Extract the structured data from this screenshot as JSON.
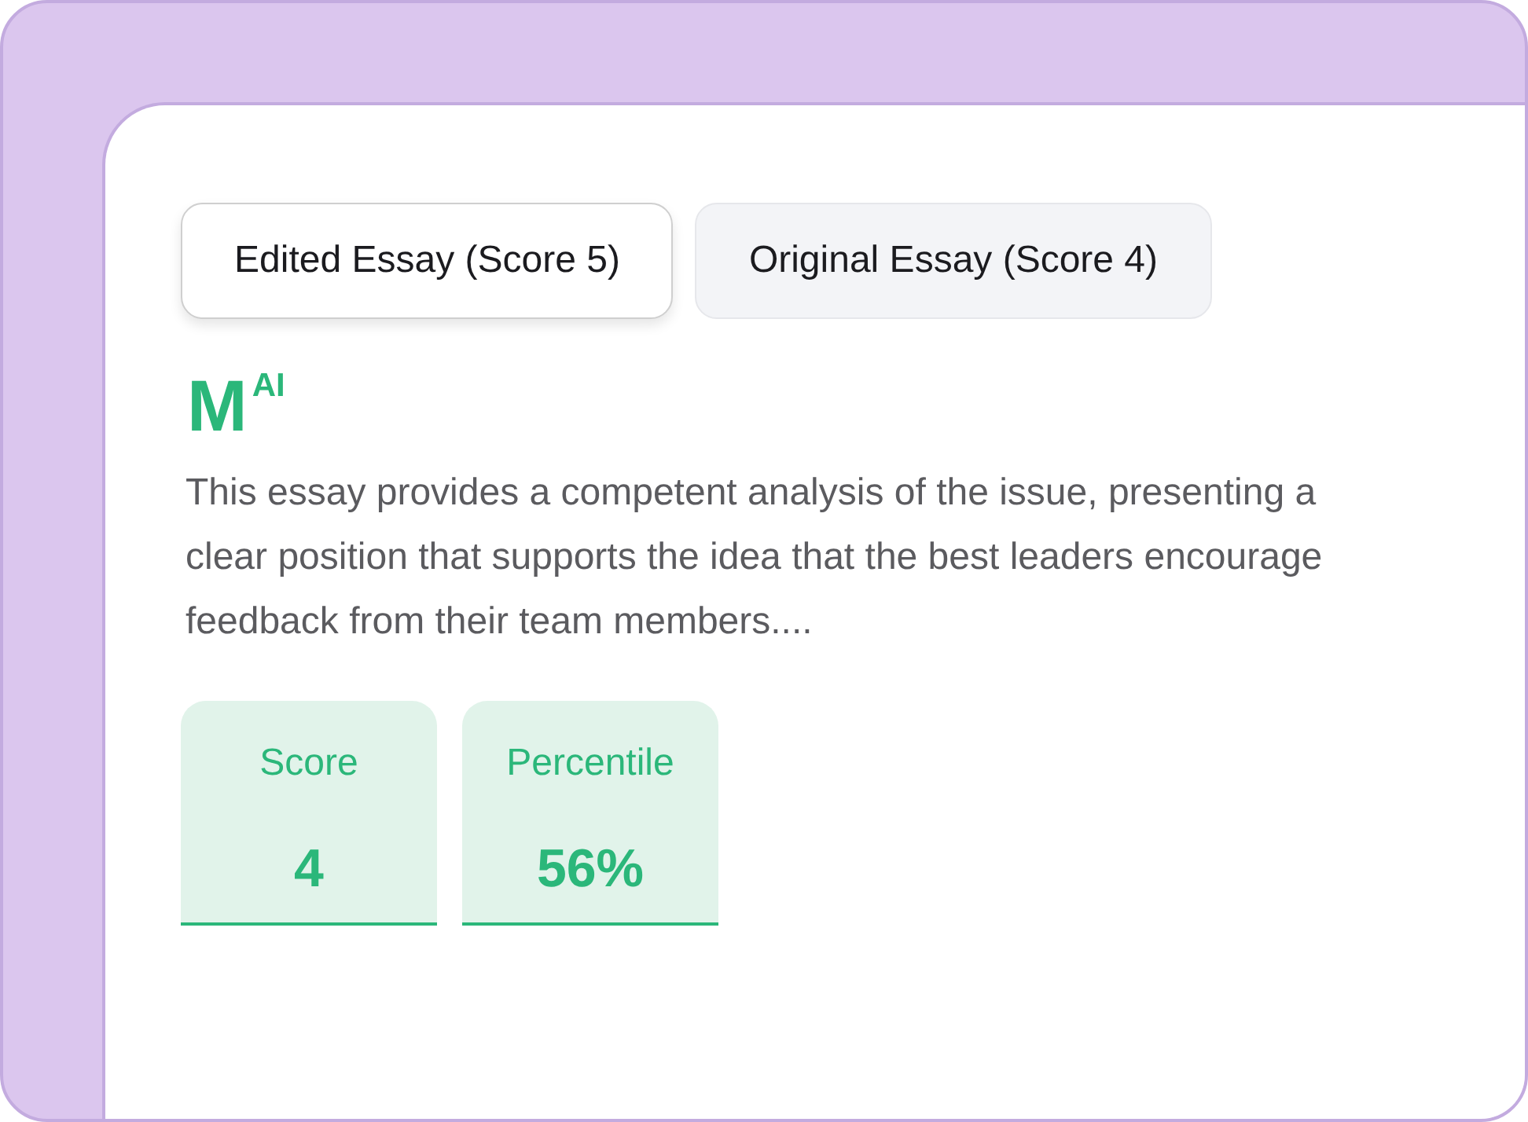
{
  "tabs": [
    {
      "label": "Edited Essay (Score 5)",
      "selected": true
    },
    {
      "label": "Original Essay (Score 4)",
      "selected": false
    }
  ],
  "logo": {
    "text": "M$^{AI}$"
  },
  "summary": "This essay provides a competent analysis of the issue, presenting a clear position that supports the idea that the best leaders encourage feedback from their team members....",
  "stats": [
    {
      "label": "Score",
      "value": "4"
    },
    {
      "label": "Percentile",
      "value": "56%"
    }
  ]
}
